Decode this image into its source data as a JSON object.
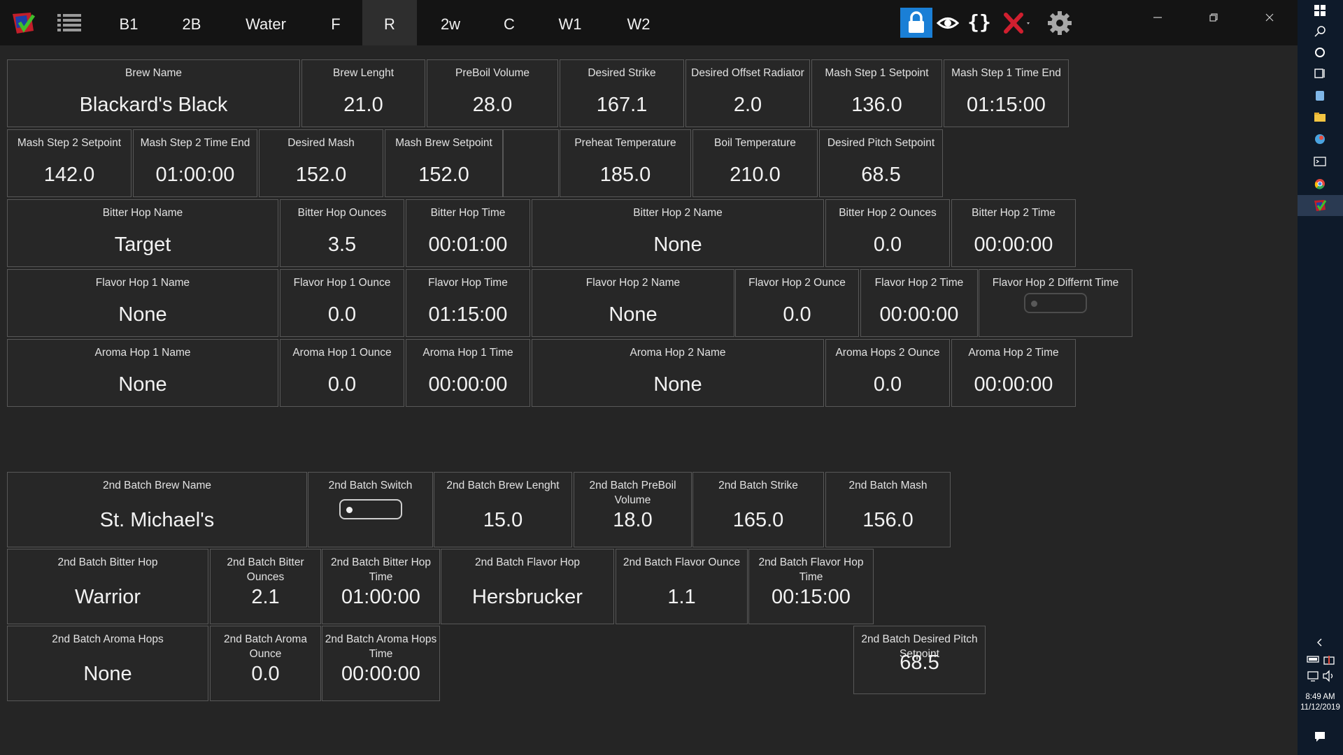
{
  "nav": {
    "tabs": [
      {
        "label": "B1",
        "active": false
      },
      {
        "label": "2B",
        "active": false
      },
      {
        "label": "Water",
        "active": false
      },
      {
        "label": "F",
        "active": false
      },
      {
        "label": "R",
        "active": true
      },
      {
        "label": "2w",
        "active": false
      },
      {
        "label": "C",
        "active": false
      },
      {
        "label": "W1",
        "active": false
      },
      {
        "label": "W2",
        "active": false
      }
    ]
  },
  "toolbar": {
    "icons": [
      "lock-icon",
      "eye-icon",
      "braces-icon",
      "close-x-icon",
      "gear-icon"
    ],
    "braces_text": "{}"
  },
  "colors": {
    "accent": "#1a7fd6",
    "danger": "#d01f2f",
    "background": "#252525",
    "tile_border": "#585858"
  },
  "taskbar": {
    "time": "8:49 AM",
    "date": "11/12/2019"
  },
  "recipe": {
    "brew_name": {
      "label": "Brew Name",
      "value": "Blackard's Black"
    },
    "brew_length": {
      "label": "Brew Lenght",
      "value": "21.0"
    },
    "preboil_volume": {
      "label": "PreBoil Volume",
      "value": "28.0"
    },
    "desired_strike": {
      "label": "Desired Strike",
      "value": "167.1"
    },
    "desired_offset_radiator": {
      "label": "Desired Offset Radiator",
      "value": "2.0"
    },
    "mash_step1_setpoint": {
      "label": "Mash Step 1 Setpoint",
      "value": "136.0"
    },
    "mash_step1_time_end": {
      "label": "Mash Step 1 Time End",
      "value": "01:15:00"
    },
    "mash_step2_setpoint": {
      "label": "Mash Step 2 Setpoint",
      "value": "142.0"
    },
    "mash_step2_time_end": {
      "label": "Mash Step 2 Time End",
      "value": "01:00:00"
    },
    "desired_mash": {
      "label": "Desired Mash",
      "value": "152.0"
    },
    "mash_brew_setpoint": {
      "label": "Mash Brew Setpoint",
      "value": "152.0"
    },
    "preheat_temperature": {
      "label": "Preheat Temperature",
      "value": "185.0"
    },
    "boil_temperature": {
      "label": "Boil Temperature",
      "value": "210.0"
    },
    "desired_pitch_setpoint": {
      "label": "Desired Pitch Setpoint",
      "value": "68.5"
    },
    "bitter_hop_name": {
      "label": "Bitter Hop Name",
      "value": "Target"
    },
    "bitter_hop_ounces": {
      "label": "Bitter Hop Ounces",
      "value": "3.5"
    },
    "bitter_hop_time": {
      "label": "Bitter Hop Time",
      "value": "00:01:00"
    },
    "bitter_hop2_name": {
      "label": "Bitter Hop 2 Name",
      "value": "None"
    },
    "bitter_hop2_ounces": {
      "label": "Bitter Hop 2 Ounces",
      "value": "0.0"
    },
    "bitter_hop2_time": {
      "label": "Bitter Hop 2 Time",
      "value": "00:00:00"
    },
    "flavor_hop1_name": {
      "label": "Flavor Hop 1 Name",
      "value": "None"
    },
    "flavor_hop1_ounce": {
      "label": "Flavor Hop 1 Ounce",
      "value": "0.0"
    },
    "flavor_hop_time": {
      "label": "Flavor Hop Time",
      "value": "01:15:00"
    },
    "flavor_hop2_name": {
      "label": "Flavor Hop 2 Name",
      "value": "None"
    },
    "flavor_hop2_ounce": {
      "label": "Flavor Hop 2 Ounce",
      "value": "0.0"
    },
    "flavor_hop2_time": {
      "label": "Flavor Hop 2 Time",
      "value": "00:00:00"
    },
    "flavor_hop2_different_time": {
      "label": "Flavor Hop 2 Differnt Time",
      "state": "off"
    },
    "aroma_hop1_name": {
      "label": "Aroma Hop 1 Name",
      "value": "None"
    },
    "aroma_hop1_ounce": {
      "label": "Aroma Hop 1 Ounce",
      "value": "0.0"
    },
    "aroma_hop1_time": {
      "label": "Aroma Hop 1 Time",
      "value": "00:00:00"
    },
    "aroma_hop2_name": {
      "label": "Aroma Hop 2 Name",
      "value": "None"
    },
    "aroma_hops2_ounce": {
      "label": "Aroma Hops 2 Ounce",
      "value": "0.0"
    },
    "aroma_hop2_time": {
      "label": "Aroma Hop 2 Time",
      "value": "00:00:00"
    }
  },
  "second_batch": {
    "brew_name": {
      "label": "2nd Batch Brew Name",
      "value": "St. Michael's"
    },
    "switch": {
      "label": "2nd Batch Switch",
      "state": "on"
    },
    "brew_length": {
      "label": "2nd Batch Brew Lenght",
      "value": "15.0"
    },
    "preboil_volume": {
      "label": "2nd Batch PreBoil Volume",
      "value": "18.0"
    },
    "strike": {
      "label": "2nd Batch Strike",
      "value": "165.0"
    },
    "mash": {
      "label": "2nd Batch Mash",
      "value": "156.0"
    },
    "bitter_hop": {
      "label": "2nd Batch Bitter Hop",
      "value": "Warrior"
    },
    "bitter_ounces": {
      "label": "2nd Batch Bitter Ounces",
      "value": "2.1"
    },
    "bitter_hop_time": {
      "label": "2nd Batch Bitter Hop Time",
      "value": "01:00:00"
    },
    "flavor_hop": {
      "label": "2nd Batch Flavor Hop",
      "value": "Hersbrucker"
    },
    "flavor_ounce": {
      "label": "2nd Batch Flavor Ounce",
      "value": "1.1"
    },
    "flavor_hop_time": {
      "label": "2nd Batch Flavor Hop Time",
      "value": "00:15:00"
    },
    "aroma_hops": {
      "label": "2nd Batch Aroma Hops",
      "value": "None"
    },
    "aroma_ounce": {
      "label": "2nd Batch Aroma Ounce",
      "value": "0.0"
    },
    "aroma_hops_time": {
      "label": "2nd Batch Aroma Hops Time",
      "value": "00:00:00"
    },
    "desired_pitch_setpoint": {
      "label": "2nd Batch Desired Pitch Setpoint",
      "value": "68.5"
    }
  }
}
